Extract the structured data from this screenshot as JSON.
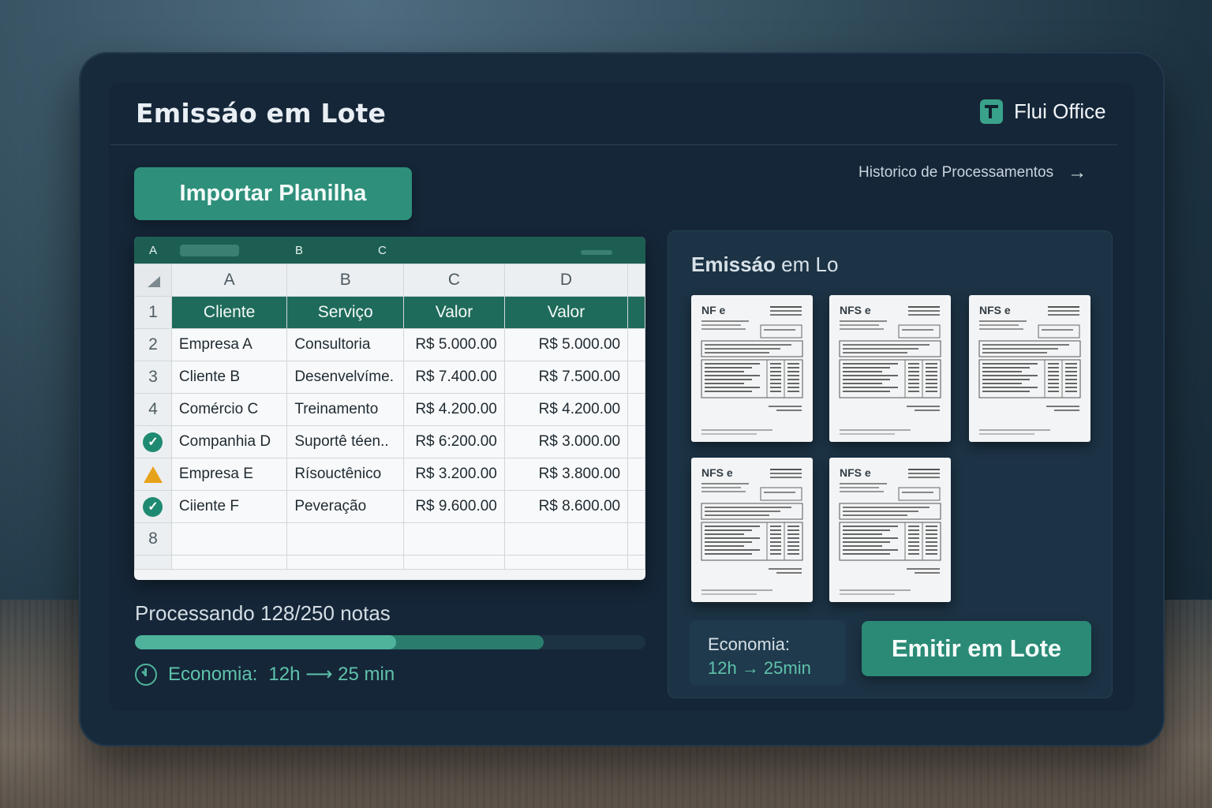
{
  "app": {
    "title": "Emissáo em Lote"
  },
  "brand": {
    "name": "Flui Office",
    "logo_icon": "flui-logo-icon",
    "accent": "#2e8f7b"
  },
  "header": {
    "history_link": "Historico de Processamentos",
    "history_icon": "arrow-right-icon"
  },
  "import_button": {
    "label": "Importar Planilha"
  },
  "sheet": {
    "topbar_labels": [
      "A",
      "B",
      "C"
    ],
    "column_letters": [
      "A",
      "B",
      "C",
      "D"
    ],
    "header_row_number": "1",
    "headers": [
      "Cliente",
      "Serviço",
      "Valor",
      "Valor"
    ],
    "rows": [
      {
        "marker": "2",
        "status": "none",
        "cells": [
          "Empresa A",
          "Consultoria",
          "R$ 5.000.00",
          "R$ 5.000.00"
        ]
      },
      {
        "marker": "3",
        "status": "none",
        "cells": [
          "Cliente B",
          "Desenvelvíme.",
          "R$ 7.400.00",
          "R$ 7.500.00"
        ]
      },
      {
        "marker": "4",
        "status": "none",
        "cells": [
          "Comércio C",
          "Treinamento",
          "R$ 4.200.00",
          "R$ 4.200.00"
        ]
      },
      {
        "marker": "",
        "status": "ok",
        "cells": [
          "Companhia D",
          "Suportê téen..",
          "R$ 6:200.00",
          "R$ 3.000.00"
        ]
      },
      {
        "marker": "",
        "status": "warning",
        "cells": [
          "Empresa E",
          "Rísouctênico",
          "R$ 3.200.00",
          "R$ 3.800.00"
        ]
      },
      {
        "marker": "",
        "status": "ok",
        "cells": [
          "Ciiente F",
          "Peveração",
          "R$ 9.600.00",
          "R$ 8.600.00"
        ]
      },
      {
        "marker": "8",
        "status": "none",
        "cells": [
          "",
          "",
          "",
          ""
        ]
      }
    ]
  },
  "progress": {
    "label": "Processando 128/250 notas",
    "processed": 128,
    "total": 250,
    "buffer_fraction": 0.8,
    "economy_label": "Economia:",
    "economy_value": "12h ⟶ 25 min"
  },
  "panel": {
    "title_bold": "Emissáo",
    "title_rest": " em Lo",
    "documents": [
      {
        "label": "NF e"
      },
      {
        "label": "NFS e"
      },
      {
        "label": "NFS e"
      },
      {
        "label": "NFS e"
      },
      {
        "label": "NFS e"
      }
    ],
    "economy_card": {
      "label": "Economia:",
      "value": "12h  →  25min"
    },
    "emit_button": {
      "label": "Emitir em Lote"
    }
  }
}
